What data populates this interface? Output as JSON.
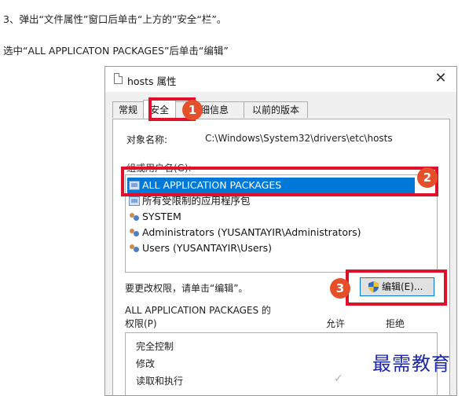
{
  "instructions": {
    "step3": "3、弹出“文件属性”窗口后单击“上方的”安全“栏”。",
    "select": "选中“ALL APPLICATON PACKAGES”后单击“编辑”"
  },
  "dialog": {
    "title": "hosts 属性",
    "close_icon": "close-icon",
    "tabs": [
      "常规",
      "安全",
      "详细信息",
      "以前的版本"
    ],
    "active_tab": "安全",
    "object_name_label": "对象名称:",
    "object_name_value": "C:\\Windows\\System32\\drivers\\etc\\hosts",
    "group_label": "组或用户名(G):",
    "users": [
      {
        "name": "ALL APPLICATION PACKAGES",
        "icon": "package-icon",
        "selected": true
      },
      {
        "name": "所有受限制的应用程序包",
        "icon": "package-icon",
        "selected": false
      },
      {
        "name": "SYSTEM",
        "icon": "users-icon",
        "selected": false
      },
      {
        "name": "Administrators (YUSANTAYIR\\Administrators)",
        "icon": "users-icon",
        "selected": false
      },
      {
        "name": "Users (YUSANTAYIR\\Users)",
        "icon": "users-icon",
        "selected": false
      }
    ],
    "change_text": "要更改权限，请单击“编辑”。",
    "edit_button": "编辑(E)...",
    "permissions_title": "ALL APPLICATION PACKAGES 的",
    "permissions_label": "权限(P)",
    "allow_label": "允许",
    "deny_label": "拒绝",
    "permissions": [
      "完全控制",
      "修改",
      "读取和执行"
    ],
    "read_execute_check": "✓"
  },
  "callouts": [
    "1",
    "2",
    "3"
  ],
  "watermark": "最需教育",
  "colors": {
    "highlight": "#e0102a",
    "badge": "#e5502a",
    "selection": "#0078d7",
    "watermark": "#1d28a8"
  }
}
